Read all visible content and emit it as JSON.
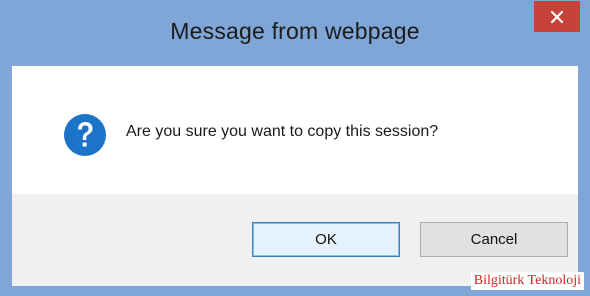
{
  "dialog": {
    "title": "Message from webpage",
    "message": "Are you sure you want to copy this session?",
    "ok_label": "OK",
    "cancel_label": "Cancel",
    "close_icon": "close-icon",
    "message_icon": "question-icon"
  },
  "watermark": {
    "text": "Bilgitürk Teknoloji"
  },
  "colors": {
    "frame": "#7fa6d6",
    "close_button": "#c7433a",
    "question_icon": "#1b74c7",
    "footer": "#f0f0f0",
    "watermark": "#d12323"
  }
}
